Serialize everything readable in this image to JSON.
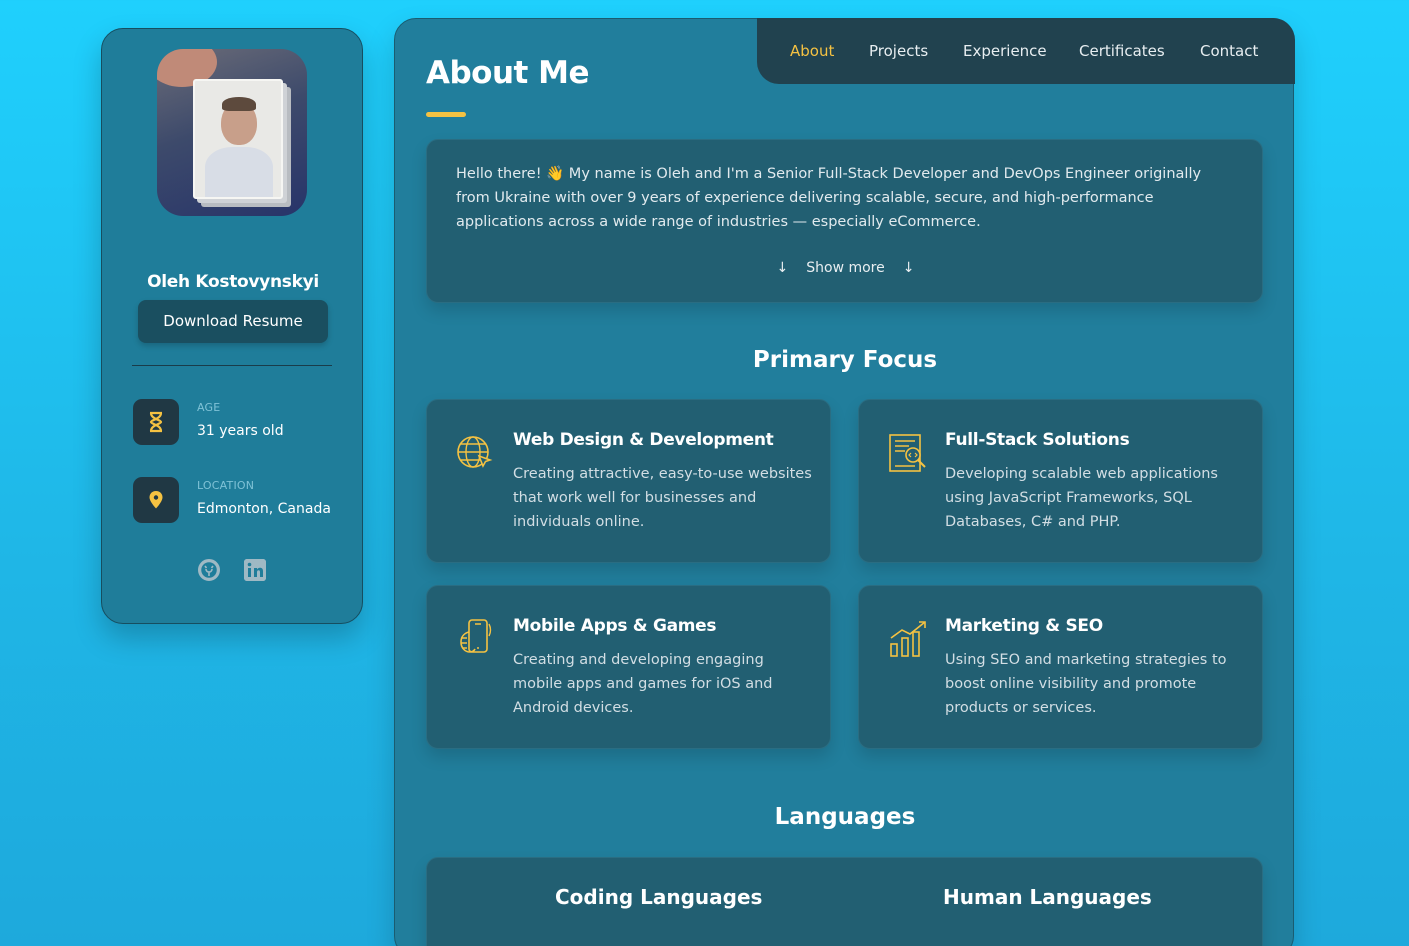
{
  "profile": {
    "name": "Oleh Kostovynskyi",
    "resume_button": "Download Resume",
    "age": {
      "label": "AGE",
      "value": "31 years old",
      "icon": "hourglass-icon"
    },
    "location": {
      "label": "LOCATION",
      "value": "Edmonton, Canada",
      "icon": "map-pin-icon"
    },
    "social": {
      "github_icon": "github-icon",
      "linkedin_icon": "linkedin-icon"
    }
  },
  "nav": {
    "items": [
      "About",
      "Projects",
      "Experience",
      "Certificates",
      "Contact"
    ],
    "active": "About"
  },
  "about": {
    "title": "About Me",
    "text": "Hello there! 👋 My name is Oleh and I'm a Senior Full-Stack Developer and DevOps Engineer originally from Ukraine with over 9 years of experience delivering scalable, secure, and high-performance applications across a wide range of industries — especially eCommerce.",
    "show_more": "Show more",
    "arrow": "↓"
  },
  "focus": {
    "title": "Primary Focus",
    "cards": [
      {
        "title": "Web Design & Development",
        "desc": "Creating attractive, easy-to-use websites that work well for businesses and individuals online.",
        "icon": "globe-cursor-icon"
      },
      {
        "title": "Full-Stack Solutions",
        "desc": "Developing scalable web applications using JavaScript Frameworks, SQL Databases, C# and PHP.",
        "icon": "code-document-icon"
      },
      {
        "title": "Mobile Apps & Games",
        "desc": "Creating and developing engaging mobile apps and games for iOS and Android devices.",
        "icon": "hand-phone-icon"
      },
      {
        "title": "Marketing & SEO",
        "desc": "Using SEO and marketing strategies to boost online visibility and promote products or services.",
        "icon": "growth-chart-icon"
      }
    ]
  },
  "languages": {
    "title": "Languages",
    "coding": "Coding Languages",
    "human": "Human Languages"
  },
  "colors": {
    "accent": "#f5c242",
    "background": "#1fc3f3",
    "panel": "#217e9c",
    "card": "#225f72",
    "nav": "#21424f"
  }
}
